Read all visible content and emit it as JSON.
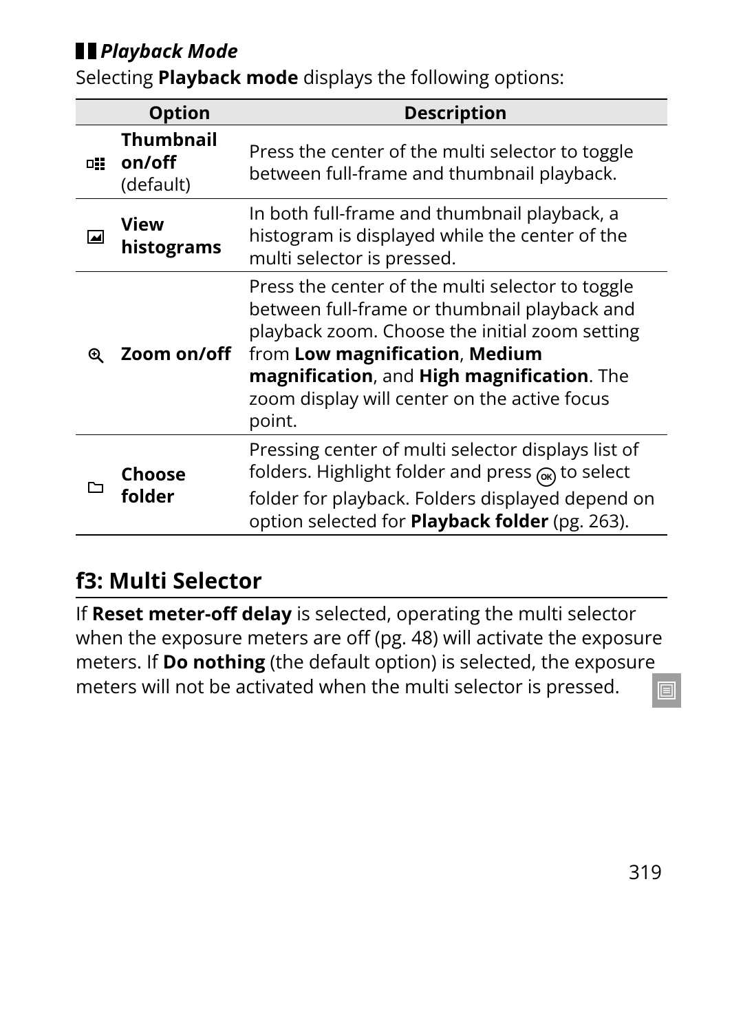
{
  "section": {
    "title": "Playback Mode",
    "intro_pre": "Selecting ",
    "intro_bold": "Playback mode",
    "intro_post": " displays the following options:"
  },
  "table": {
    "headers": {
      "option": "Option",
      "description": "Description"
    },
    "rows": [
      {
        "icon": "thumbnail-icon",
        "option_bold": "Thumbnail on/off",
        "option_plain": " (default)",
        "desc_html": "Press the center of the multi selector to toggle between full-frame and thumbnail playback."
      },
      {
        "icon": "histogram-icon",
        "option_bold": "View histograms",
        "option_plain": "",
        "desc_html": "In both full-frame and thumbnail playback, a histogram is displayed while the center of the multi selector is pressed."
      },
      {
        "icon": "zoom-icon",
        "option_bold": "Zoom on/off",
        "option_plain": "",
        "desc_html": "Press the center of the multi selector to toggle between full-frame or thumbnail playback and playback zoom.  Choose the initial zoom setting from <b>Low magnification</b>, <b>Medium magnification</b>, and <b>High magnification</b>.  The zoom display will center on the active focus point."
      },
      {
        "icon": "folder-icon",
        "option_bold": "Choose folder",
        "option_plain": "",
        "desc_html": "Pressing center of multi selector displays list of folders.  Highlight folder and press {OK} to select folder for playback.  Folders displayed depend on option selected for <b>Playback folder</b> (pg. 263)."
      }
    ]
  },
  "custom": {
    "heading": "f3: Multi Selector",
    "para_parts": {
      "p1": "If ",
      "b1": "Reset meter-off delay",
      "p2": " is selected, operating the multi selector when the exposure meters are off (pg. 48) will activate the exposure meters.  If ",
      "b2": "Do nothing",
      "p3": " (the default option) is selected, the exposure meters will not be activated when the multi selector is pressed."
    }
  },
  "side_tab_icon": "menu-tab-icon",
  "page_number": "319"
}
